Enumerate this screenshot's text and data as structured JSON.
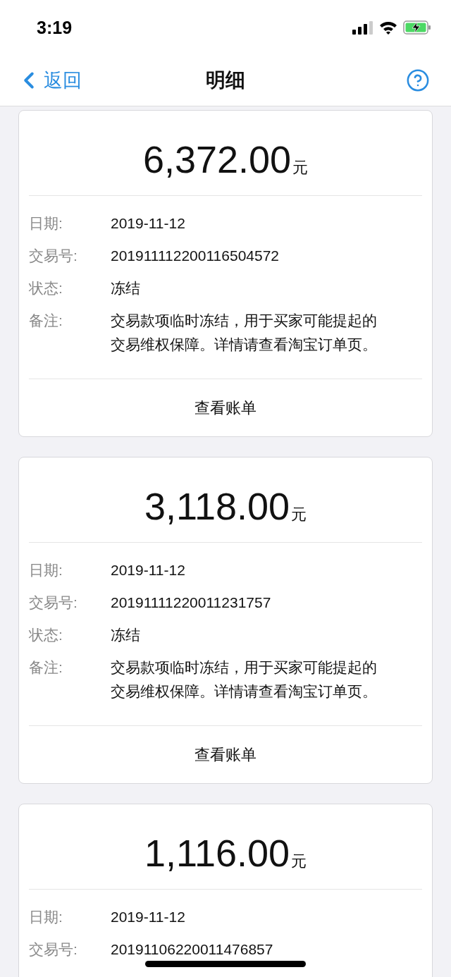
{
  "status_bar": {
    "time": "3:19"
  },
  "nav": {
    "back": "返回",
    "title": "明细"
  },
  "cards": [
    {
      "amount": "6,372.00",
      "unit": "元",
      "fields": [
        {
          "label": "日期:",
          "value": "2019-11-12"
        },
        {
          "label": "交易号:",
          "value": "201911112200116504572"
        },
        {
          "label": "状态:",
          "value": "冻结"
        },
        {
          "label": "备注:",
          "value": "交易款项临时冻结，用于买家可能提起的交易维权保障。详情请查看淘宝订单页。"
        }
      ],
      "button": "查看账单"
    },
    {
      "amount": "3,118.00",
      "unit": "元",
      "fields": [
        {
          "label": "日期:",
          "value": "2019-11-12"
        },
        {
          "label": "交易号:",
          "value": "20191111220011231757"
        },
        {
          "label": "状态:",
          "value": "冻结"
        },
        {
          "label": "备注:",
          "value": "交易款项临时冻结，用于买家可能提起的交易维权保障。详情请查看淘宝订单页。"
        }
      ],
      "button": "查看账单"
    },
    {
      "amount": "1,116.00",
      "unit": "元",
      "fields": [
        {
          "label": "日期:",
          "value": "2019-11-12"
        },
        {
          "label": "交易号:",
          "value": "20191106220011476857"
        }
      ]
    }
  ]
}
